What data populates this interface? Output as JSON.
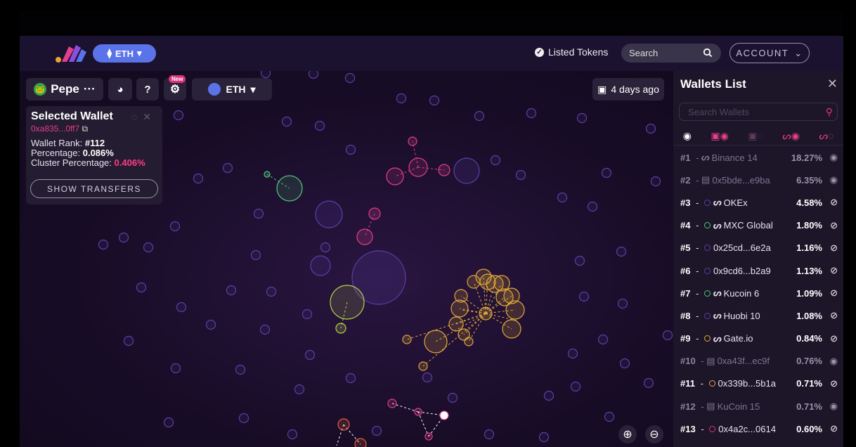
{
  "navbar": {
    "network_label": "ETH",
    "listed_tokens_label": "Listed Tokens",
    "search_placeholder": "Search",
    "account_label": "ACCOUNT"
  },
  "toolbar": {
    "token_name": "Pepe",
    "token_more": "···",
    "new_badge": "New",
    "network_label": "ETH",
    "time_label": "4 days ago"
  },
  "selected_wallet": {
    "title": "Selected Wallet",
    "address": "0xa835...0ff7",
    "rank_label": "Wallet Rank:",
    "rank_value": "#112",
    "percentage_label": "Percentage:",
    "percentage_value": "0.086%",
    "cluster_label": "Cluster Percentage:",
    "cluster_value": "0.406%",
    "show_transfers": "SHOW TRANSFERS"
  },
  "wallets_panel": {
    "title": "Wallets List",
    "search_placeholder": "Search Wallets",
    "rows": [
      {
        "rank": "#1",
        "sep": " - ",
        "name": "Binance 14",
        "pct": "18.27%",
        "dim": true,
        "kind": "exchange",
        "dot": null,
        "eye": "visible"
      },
      {
        "rank": "#2",
        "sep": " - ",
        "name": "0x5bde...e9ba",
        "pct": "6.35%",
        "dim": true,
        "kind": "contract",
        "dot": null,
        "eye": "visible"
      },
      {
        "rank": "#3",
        "sep": " - ",
        "name": "OKEx",
        "pct": "4.58%",
        "dim": false,
        "kind": "exchange",
        "dot": "#5a3fa8",
        "eye": "hidden"
      },
      {
        "rank": "#4",
        "sep": " - ",
        "name": "MXC Global",
        "pct": "1.80%",
        "dim": false,
        "kind": "exchange",
        "dot": "#4fc87a",
        "eye": "hidden"
      },
      {
        "rank": "#5",
        "sep": " - ",
        "name": "0x25cd...6e2a",
        "pct": "1.16%",
        "dim": false,
        "kind": "wallet",
        "dot": "#5a3fa8",
        "eye": "hidden"
      },
      {
        "rank": "#6",
        "sep": " - ",
        "name": "0x9cd6...b2a9",
        "pct": "1.13%",
        "dim": false,
        "kind": "wallet",
        "dot": "#5a3fa8",
        "eye": "hidden"
      },
      {
        "rank": "#7",
        "sep": " - ",
        "name": "Kucoin 6",
        "pct": "1.09%",
        "dim": false,
        "kind": "exchange",
        "dot": "#4fc87a",
        "eye": "hidden"
      },
      {
        "rank": "#8",
        "sep": " - ",
        "name": "Huobi 10",
        "pct": "1.08%",
        "dim": false,
        "kind": "exchange",
        "dot": "#5a3fa8",
        "eye": "hidden"
      },
      {
        "rank": "#9",
        "sep": " - ",
        "name": "Gate.io",
        "pct": "0.84%",
        "dim": false,
        "kind": "exchange",
        "dot": "#e0a83a",
        "eye": "hidden"
      },
      {
        "rank": "#10",
        "sep": " - ",
        "name": "0xa43f...ec9f",
        "pct": "0.76%",
        "dim": true,
        "kind": "contract",
        "dot": null,
        "eye": "visible"
      },
      {
        "rank": "#11",
        "sep": " - ",
        "name": "0x339b...5b1a",
        "pct": "0.71%",
        "dim": false,
        "kind": "wallet",
        "dot": "#e0a83a",
        "eye": "hidden"
      },
      {
        "rank": "#12",
        "sep": " - ",
        "name": "KuCoin 15",
        "pct": "0.71%",
        "dim": true,
        "kind": "contract",
        "dot": null,
        "eye": "visible"
      },
      {
        "rank": "#13",
        "sep": " - ",
        "name": "0x4a2c...0614",
        "pct": "0.60%",
        "dim": false,
        "kind": "wallet",
        "dot": "#d6338a",
        "eye": "hidden"
      }
    ]
  },
  "colors": {
    "accent_pink": "#e23f8a",
    "eth_blue": "#5b73e8",
    "bubble_purple": "#5a3fa8",
    "bubble_gold": "#e0a83a",
    "bubble_green": "#4fc87a",
    "bubble_lime": "#b8d04a"
  }
}
